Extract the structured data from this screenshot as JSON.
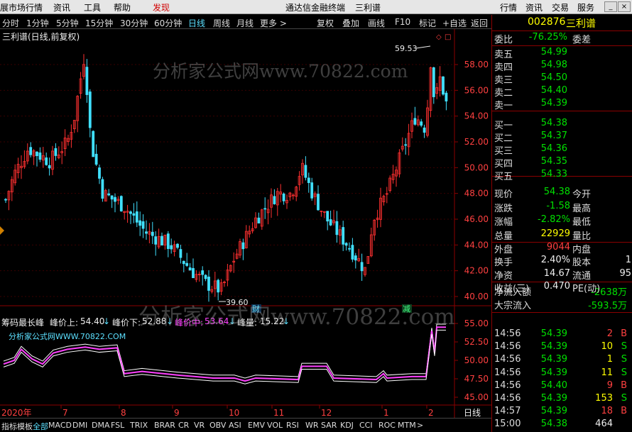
{
  "menubar": {
    "left_items": [
      "展市场行情",
      "资讯",
      "工具",
      "帮助"
    ],
    "discover": "发现",
    "title": "通达信金融终端",
    "stock_name": "三利谱",
    "right_items": [
      "行情",
      "资讯",
      "交易",
      "服务"
    ]
  },
  "periods": [
    "分时",
    "1分钟",
    "5分钟",
    "15分钟",
    "30分钟",
    "60分钟",
    "日线",
    "周线",
    "月线",
    "更多 >"
  ],
  "active_period": "日线",
  "toolbar": [
    "复权",
    "叠加",
    "画线",
    "F10",
    "标记",
    "+自选",
    "返回"
  ],
  "chart": {
    "title": "三利谱(日线,前复权)",
    "high_label": "59.53",
    "low_label": "39.60",
    "watermark": "分析家公式网www.70822.com",
    "y_ticks": [
      "58.00",
      "56.00",
      "54.00",
      "52.00",
      "50.00",
      "48.00",
      "46.00",
      "44.00",
      "42.00",
      "40.00"
    ],
    "marker_cai": "财",
    "marker_jian": "减",
    "up_color": "#ff3030",
    "down_color": "#40e0ff"
  },
  "indicator": {
    "name": "筹码最长峰",
    "fields": [
      {
        "label": "峰价上:",
        "value": "54.40",
        "color": "#eeeeee"
      },
      {
        "label": "峰价下:",
        "value": "52.88",
        "color": "#eeeeee"
      },
      {
        "label": "峰价中:",
        "value": "53.64",
        "color": "#ff40ff"
      },
      {
        "label": "峰量:",
        "value": "15.22",
        "color": "#eeeeee"
      }
    ],
    "site": "分析家公式网WWW.70822.COM",
    "y_ticks": [
      "55.00",
      "52.50",
      "50.00",
      "47.50",
      "45.00"
    ],
    "watermark": "分析家公式网www.70822.com"
  },
  "x_axis": {
    "year": "2020年",
    "months": [
      "7",
      "8",
      "9",
      "10",
      "11",
      "12",
      "1",
      "2"
    ],
    "period": "日线"
  },
  "bottom_tabs": [
    "指标",
    "模板",
    "全部",
    "MACD",
    "DMI",
    "DMA",
    "FSL",
    "TRIX",
    "BRAR",
    "CR",
    "VR",
    "OBV",
    "ASI",
    "EMV",
    "VOL",
    "RSI",
    "WR",
    "SAR",
    "KDJ",
    "CCI",
    "ROC",
    "MTM",
    ">"
  ],
  "active_tab": "全部",
  "quote": {
    "code": "002876",
    "name": "三利谱",
    "weibi_label": "委比",
    "weibi": "-76.25%",
    "weicha_label": "委差",
    "sells": [
      {
        "label": "卖五",
        "price": "54.99"
      },
      {
        "label": "卖四",
        "price": "54.98"
      },
      {
        "label": "卖三",
        "price": "54.50"
      },
      {
        "label": "卖二",
        "price": "54.40"
      },
      {
        "label": "卖一",
        "price": "54.39"
      }
    ],
    "buys": [
      {
        "label": "买一",
        "price": "54.38"
      },
      {
        "label": "买二",
        "price": "54.37"
      },
      {
        "label": "买三",
        "price": "54.36"
      },
      {
        "label": "买四",
        "price": "54.35"
      },
      {
        "label": "买五",
        "price": "54.33"
      }
    ],
    "stats": [
      {
        "l1": "现价",
        "v1": "54.38",
        "c1": "green",
        "l2": "今开"
      },
      {
        "l1": "涨跌",
        "v1": "-1.58",
        "c1": "green",
        "l2": "最高"
      },
      {
        "l1": "涨幅",
        "v1": "-2.82%",
        "c1": "green",
        "l2": "最低"
      },
      {
        "l1": "总量",
        "v1": "22929",
        "c1": "yellow",
        "l2": "量比"
      },
      {
        "l1": "外盘",
        "v1": "9044",
        "c1": "red",
        "l2": "内盘"
      }
    ],
    "stats2": [
      {
        "l1": "换手",
        "v1": "2.40%",
        "l2": "股本",
        "v2": "1"
      },
      {
        "l1": "净资",
        "v1": "14.67",
        "l2": "流通",
        "v2": "95"
      },
      {
        "l1": "收益(三)",
        "v1": "0.470",
        "l2": "PE(动)",
        "v2": ""
      }
    ],
    "netflow_label": "净流入额",
    "netflow": "-2638万",
    "bigflow_label": "大宗流入",
    "bigflow": "-593.5万",
    "ticks": [
      {
        "time": "14:56",
        "price": "54.39",
        "vol": "2",
        "dir": "B"
      },
      {
        "time": "14:56",
        "price": "54.39",
        "vol": "10",
        "dir": "S"
      },
      {
        "time": "14:56",
        "price": "54.39",
        "vol": "1",
        "dir": "S"
      },
      {
        "time": "14:56",
        "price": "54.39",
        "vol": "11",
        "dir": "S"
      },
      {
        "time": "14:56",
        "price": "54.40",
        "vol": "9",
        "dir": "B"
      },
      {
        "time": "14:56",
        "price": "54.39",
        "vol": "153",
        "dir": "S"
      },
      {
        "time": "14:57",
        "price": "54.39",
        "vol": "18",
        "dir": "B"
      },
      {
        "time": "15:00",
        "price": "54.38",
        "vol": "464",
        "dir": ""
      }
    ]
  }
}
